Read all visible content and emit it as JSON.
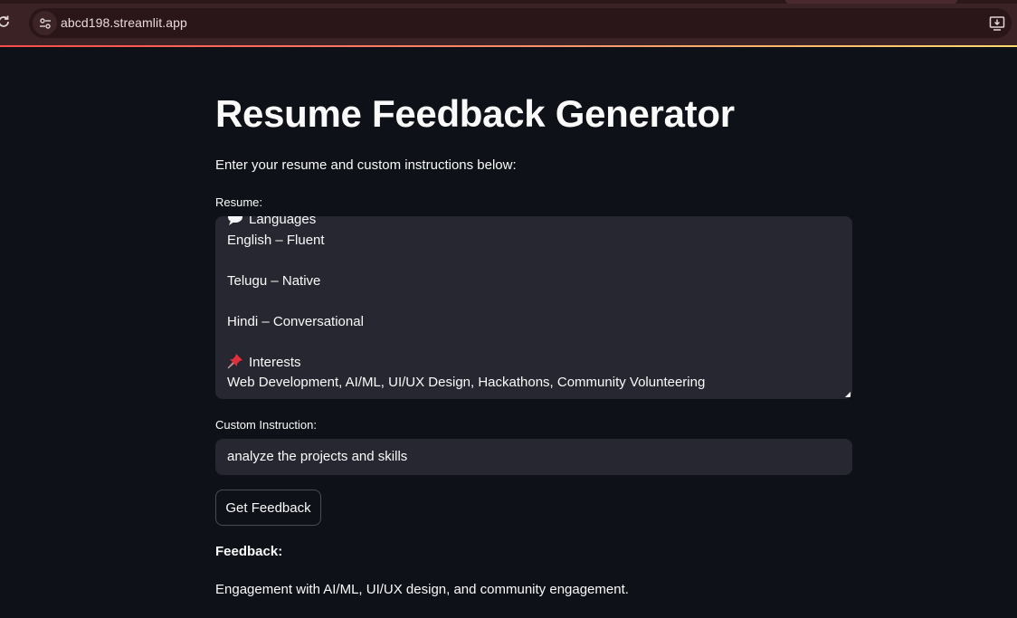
{
  "browser": {
    "url": "abcd198.streamlit.app",
    "icons": [
      "reload-icon",
      "site-info-icon",
      "install-app-icon"
    ]
  },
  "app": {
    "title": "Resume Feedback Generator",
    "subtitle": "Enter your resume and custom instructions below:",
    "resume": {
      "label": "Resume:",
      "lines": [
        "Languages",
        "English – Fluent",
        "",
        "Telugu – Native",
        "",
        "Hindi – Conversational",
        "",
        "Interests",
        "Web Development, AI/ML, UI/UX Design, Hackathons, Community Volunteering"
      ]
    },
    "instruction": {
      "label": "Custom Instruction:",
      "value": "analyze the projects and skills"
    },
    "button_label": "Get Feedback",
    "feedback": {
      "heading": "Feedback:",
      "text": "Engagement with AI/ML, UI/UX design, and community engagement."
    }
  },
  "colors": {
    "background": "#0e1117",
    "input_bg": "#262730",
    "chrome_bg": "#3b2225",
    "accent": "#ff4b4b"
  }
}
